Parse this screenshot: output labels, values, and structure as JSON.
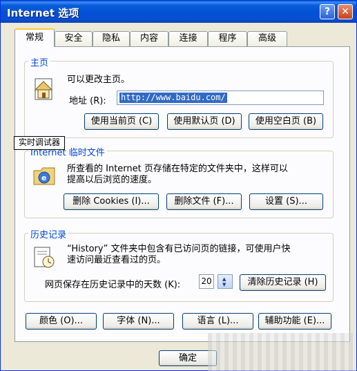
{
  "window": {
    "title": "Internet 选项"
  },
  "titlebar": {
    "help_glyph": "?",
    "close_glyph": "✕"
  },
  "tabs": [
    {
      "label": "常规",
      "active": true
    },
    {
      "label": "安全"
    },
    {
      "label": "隐私"
    },
    {
      "label": "内容"
    },
    {
      "label": "连接"
    },
    {
      "label": "程序"
    },
    {
      "label": "高级"
    }
  ],
  "homepage": {
    "group_title": "主页",
    "description": "可以更改主页。",
    "address_label": "地址 (R):",
    "address_value": "http://www.baidu.com/",
    "buttons": {
      "use_current": "使用当前页 (C)",
      "use_default": "使用默认页 (D)",
      "use_blank": "使用空白页 (B)"
    }
  },
  "tooltip": {
    "text": "实时调试器"
  },
  "temp_files": {
    "group_title": "Internet 临时文件",
    "description_line1": "所查看的 Internet 页存储在特定的文件夹中，这样可以",
    "description_line2": "提高以后浏览的速度。",
    "buttons": {
      "delete_cookies": "删除 Cookies (I)...",
      "delete_files": "删除文件 (F)...",
      "settings": "设置 (S)..."
    }
  },
  "history": {
    "group_title": "历史记录",
    "description_line1": "“History” 文件夹中包含有已访问页的链接，可使用户快",
    "description_line2": "速访问最近查看过的页。",
    "days_label": "网页保存在历史记录中的天数 (K):",
    "days_value": "20",
    "clear_button": "清除历史记录 (H)"
  },
  "bottom_buttons": {
    "colors": "颜色 (O)...",
    "fonts": "字体 (N)...",
    "languages": "语言 (L)...",
    "accessibility": "辅助功能 (E)..."
  },
  "dialog": {
    "ok": "确定"
  }
}
